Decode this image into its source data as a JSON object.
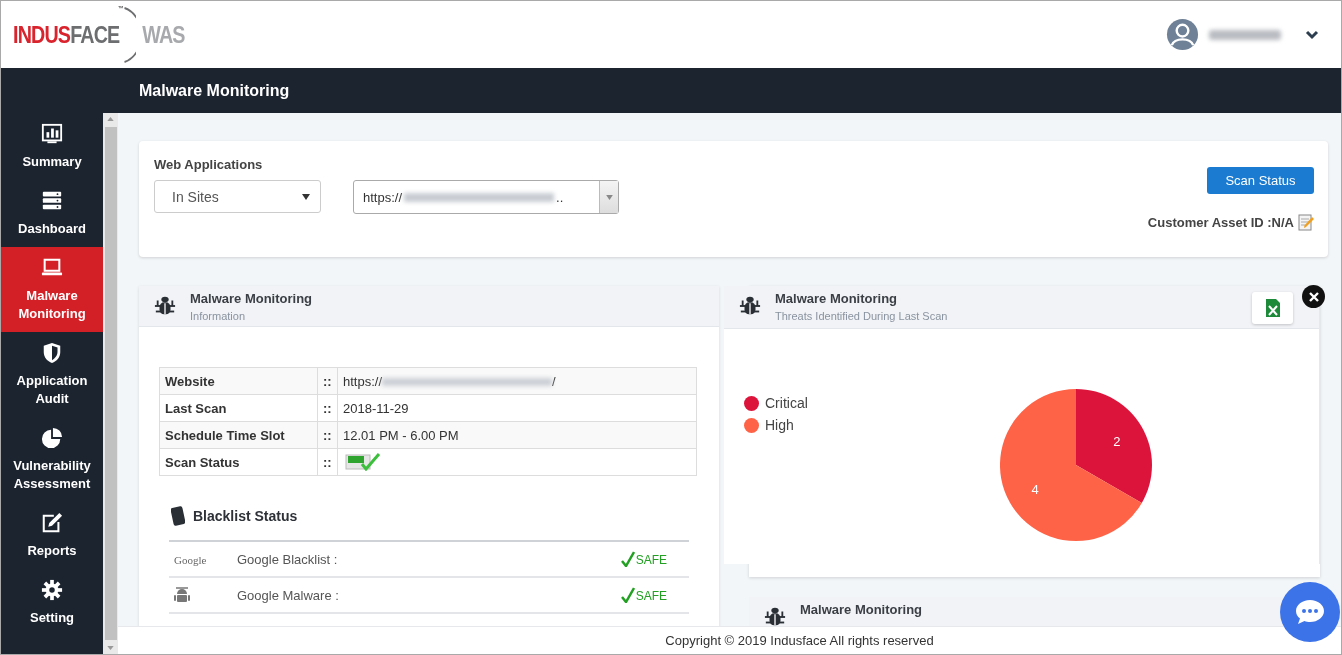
{
  "logo": {
    "part_1": "INDUS",
    "part_2": "FACE",
    "part_3": "WAS",
    "trademark": "™"
  },
  "page_title": "Malware Monitoring",
  "sidebar": {
    "items": [
      {
        "label": "Summary",
        "kind": "summary",
        "selected": false
      },
      {
        "label": "Dashboard",
        "kind": "dashboard",
        "selected": false
      },
      {
        "label": "Malware Monitoring",
        "kind": "malware",
        "selected": true
      },
      {
        "label": "Application Audit",
        "kind": "audit",
        "selected": false
      },
      {
        "label": "Vulnerability Assessment",
        "kind": "vulnerability",
        "selected": false
      },
      {
        "label": "Reports",
        "kind": "reports",
        "selected": false
      },
      {
        "label": "Setting",
        "kind": "setting",
        "selected": false
      }
    ]
  },
  "filters": {
    "label": "Web Applications",
    "site_select": "In Sites",
    "url_select": {
      "prefix": "https://",
      "suffix": ".."
    },
    "scan_status_button": "Scan Status",
    "customer_asset_id": "Customer Asset ID :N/A"
  },
  "info_panel": {
    "title": "Malware Monitoring",
    "subtitle": "Information",
    "rows": [
      {
        "label": "Website",
        "separator": "::",
        "kind": "url",
        "value": "https://",
        "suffix": "/"
      },
      {
        "label": "Last Scan",
        "separator": "::",
        "kind": "text",
        "value": "2018-11-29"
      },
      {
        "label": "Schedule Time Slot",
        "separator": "::",
        "kind": "text",
        "value": "12.01 PM - 6.00 PM"
      },
      {
        "label": "Scan Status",
        "separator": "::",
        "kind": "pass"
      }
    ],
    "blacklist": {
      "title": "Blacklist Status",
      "items": [
        {
          "kind": "google",
          "source": "Google",
          "label": "Google Blacklist :",
          "status": "SAFE",
          "safe": true
        },
        {
          "kind": "malware",
          "label": "Google Malware :",
          "status": "SAFE",
          "safe": true
        }
      ]
    }
  },
  "threat_panel": {
    "title": "Malware Monitoring",
    "subtitle": "Threats Identified During Last Scan",
    "chart_data": {
      "type": "pie",
      "categories": [
        "Critical",
        "High"
      ],
      "values": [
        2,
        4
      ],
      "colors": [
        "#dc143c",
        "#ff6347"
      ],
      "data_labels": true
    }
  },
  "summary_panel": {
    "title": "Malware Monitoring"
  },
  "footer": "Copyright © 2019 Indusface All rights reserved"
}
